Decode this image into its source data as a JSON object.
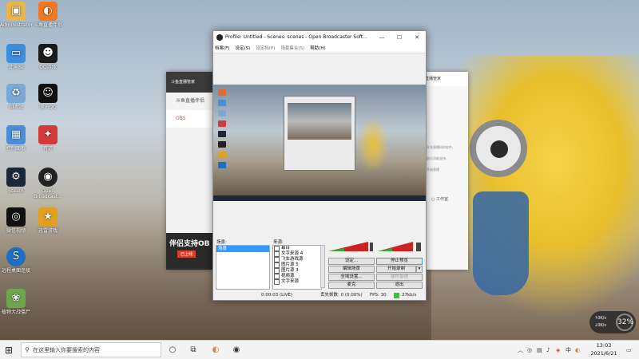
{
  "desktop": {
    "icons": [
      {
        "label": "Administrator",
        "icon": "user-folder-icon",
        "color": "#e7b54b"
      },
      {
        "label": "斗鱼直播伴侣",
        "icon": "douyu-icon",
        "color": "#f07a23"
      },
      {
        "label": "此电脑",
        "icon": "computer-icon",
        "color": "#3c8dde"
      },
      {
        "label": "QQ游戏",
        "icon": "qq-games-icon",
        "color": "#1b1b1b"
      },
      {
        "label": "回收站",
        "icon": "recycle-bin-icon",
        "color": "#7aa9d6"
      },
      {
        "label": "腾讯QQ",
        "icon": "qq-icon",
        "color": "#111111"
      },
      {
        "label": "控制面板",
        "icon": "control-panel-icon",
        "color": "#4a90d9"
      },
      {
        "label": "有道",
        "icon": "youdao-icon",
        "color": "#d33a3a"
      },
      {
        "label": "Steam",
        "icon": "steam-icon",
        "color": "#1b2838"
      },
      {
        "label": "Open Broadcast...",
        "icon": "obs-icon",
        "color": "#222222"
      },
      {
        "label": "微信视频",
        "icon": "video-app-icon",
        "color": "#111111"
      },
      {
        "label": "迅雷游戏",
        "icon": "game-center-icon",
        "color": "#e0a020"
      },
      {
        "label": "远程桌面连接",
        "icon": "remote-desktop-icon",
        "color": "#1e6fc4"
      },
      {
        "label": "植物大战僵尸",
        "icon": "pvz-icon",
        "color": "#6aa84f"
      }
    ]
  },
  "bg_left": {
    "title": "斗鱼直播管家",
    "items": [
      {
        "label": "斗鱼直播伴侣"
      },
      {
        "label": "OBS"
      }
    ],
    "ad_title": "伴侣支持OB",
    "ad_button": "已上线"
  },
  "bg_right": {
    "title": "直播管家",
    "text1": "开发直播间的软件,",
    "text2": "部分功能支持,",
    "text3": "开始直播",
    "radio_label": "工作室"
  },
  "obs": {
    "title": "Profile: Untitled - Scenes: scenes - Open Broadcaster Soft...",
    "menu": [
      "档案(F)",
      "设定(S)",
      "设定档(P)",
      "场景集合(S)",
      "帮助(H)"
    ],
    "scenes_label": "场景:",
    "scenes": [
      "场景"
    ],
    "sources_label": "来源:",
    "sources": [
      "幕目",
      "文字来源 4",
      "飞车游戏源",
      "图片源 5",
      "图片源 3",
      "视频源",
      "文字来源"
    ],
    "buttons": {
      "settings": "设定...",
      "stop_preview": "停止预览",
      "edit_scene": "编辑场景",
      "start_record": "开始录制",
      "fullscreen": "全域设置...",
      "plugins": "插件管理",
      "microphone": "麦克",
      "exit": "退出"
    },
    "status": {
      "time": "0:00:03 (LIVE)",
      "dropped": "丢失帧数: 0 (0.00%)",
      "fps": "FPS: 30",
      "bitrate": "27kb/s"
    }
  },
  "net_widget": {
    "upload": "↑0K/s",
    "download": "↓0K/s",
    "percent": "32%"
  },
  "taskbar": {
    "search_placeholder": "在这里输入你要搜索的内容",
    "ime": "中",
    "time": "13:03",
    "date": "2021/6/21"
  }
}
